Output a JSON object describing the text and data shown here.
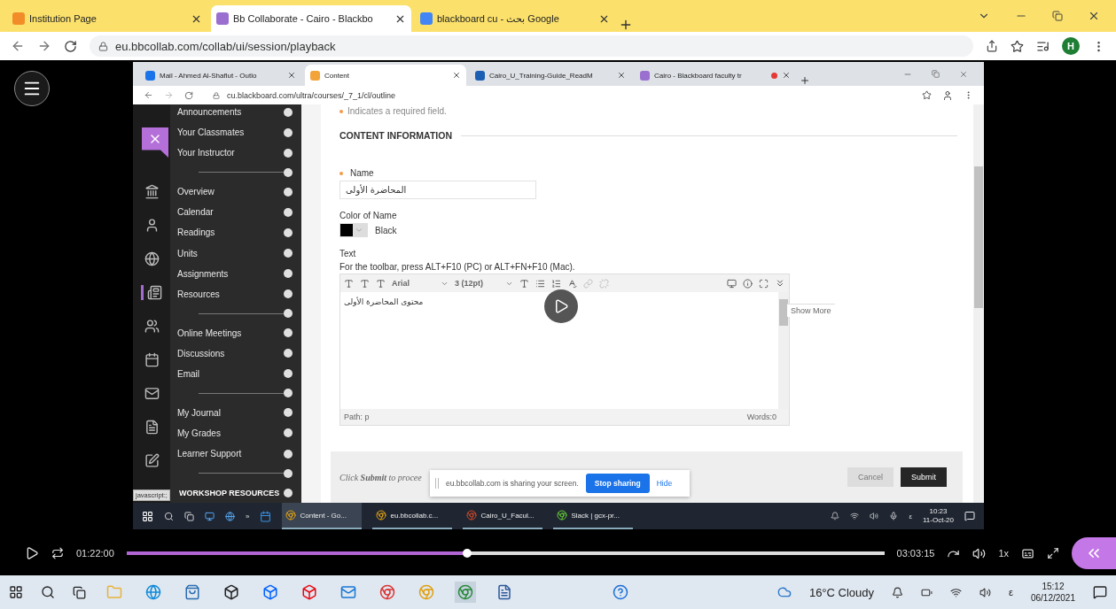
{
  "outer_browser": {
    "tabs": [
      {
        "title": "Institution Page",
        "selected": false
      },
      {
        "title": "Bb Collaborate - Cairo - Blackbo",
        "selected": true
      },
      {
        "title": "blackboard cu - بحث Google",
        "selected": false
      }
    ],
    "url": "eu.bbcollab.com/collab/ui/session/playback",
    "avatar": "H"
  },
  "inner_browser": {
    "tabs": [
      {
        "title": "Mail - Ahmed Al-Shaflut - Outlo",
        "selected": false
      },
      {
        "title": "Content",
        "selected": true
      },
      {
        "title": "Cairo_U_Training-Guide_ReadM",
        "selected": false
      },
      {
        "title": "Cairo - Blackboard faculty tr",
        "selected": false
      }
    ],
    "url": "cu.blackboard.com/ultra/courses/_7_1/cl/outline"
  },
  "course_menu": {
    "groups": [
      {
        "items": [
          "Announcements",
          "Your Classmates",
          "Your Instructor"
        ]
      },
      {
        "items": [
          "Overview",
          "Calendar",
          "Readings",
          "Units",
          "Assignments",
          "Resources"
        ]
      },
      {
        "items": [
          "Online Meetings",
          "Discussions",
          "Email"
        ]
      },
      {
        "items": [
          "My Journal",
          "My Grades",
          "Learner Support"
        ]
      },
      {
        "heading": "WORKSHOP RESOURCES"
      }
    ],
    "status_tip": "javascript:;"
  },
  "form": {
    "required_note": "Indicates a required field.",
    "section_title": "CONTENT INFORMATION",
    "name_label": "Name",
    "name_value": "المحاضرة الأولى",
    "color_label": "Color of Name",
    "color_value": "Black",
    "text_label": "Text",
    "toolbar_hint": "For the toolbar, press ALT+F10 (PC) or ALT+FN+F10 (Mac).",
    "editor": {
      "font": "Arial",
      "size": "3 (12pt)",
      "body": "محتوى المحاضرة الأولى",
      "path": "Path: p",
      "words": "Words:0",
      "tooltip": "Show More"
    },
    "submit_note": "Click **Submit** to procee",
    "buttons": [
      "Cancel",
      "Submit"
    ]
  },
  "share_banner": {
    "message": "eu.bbcollab.com is sharing your screen.",
    "stop": "Stop sharing",
    "hide": "Hide"
  },
  "inner_taskbar": {
    "chevron": "»",
    "tasks": [
      {
        "title": "Content - Go...",
        "selected": true
      },
      {
        "title": "eu.bbcollab.c...",
        "selected": false
      },
      {
        "title": "Cairo_U_Facul...",
        "selected": false
      },
      {
        "title": "Slack | gcx-pr...",
        "selected": false
      }
    ],
    "lang": "ε",
    "time": "10:23",
    "date": "11-Oct-20"
  },
  "player": {
    "elapsed": "01:22:00",
    "total": "03:03:15",
    "level": 0.45,
    "speed": "1x"
  },
  "taskbar": {
    "weather": "16°C Cloudy",
    "lang": "ε",
    "time": "15:12",
    "date": "06/12/2021"
  }
}
